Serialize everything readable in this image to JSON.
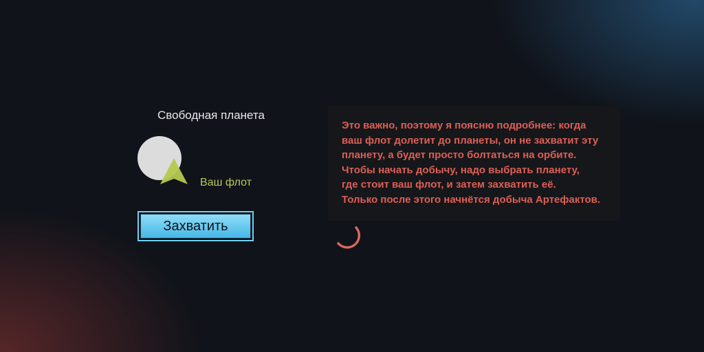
{
  "planet": {
    "title": "Свободная планета"
  },
  "fleet": {
    "label": "Ваш флот"
  },
  "actions": {
    "capture_label": "Захватить"
  },
  "hint": {
    "text": "Это важно, поэтому я поясню подробнее: когда\nваш флот долетит до планеты, он не захватит эту\nпланету, а будет просто болтаться на орбите.\nЧтобы начать добычу, надо выбрать планету,\nгде стоит ваш флот, и затем захватить её.\nТолько после этого начнётся добыча Артефактов."
  },
  "colors": {
    "hint_text": "#dd5f55",
    "fleet_label": "#b7cc55",
    "button_fill": "#45b8e6",
    "button_border": "#6fd2f4",
    "planet": "#dcdcdc"
  },
  "icons": {
    "planet": "planet-icon",
    "fleet": "fleet-arrow-icon",
    "spinner": "loading-arc-icon"
  }
}
